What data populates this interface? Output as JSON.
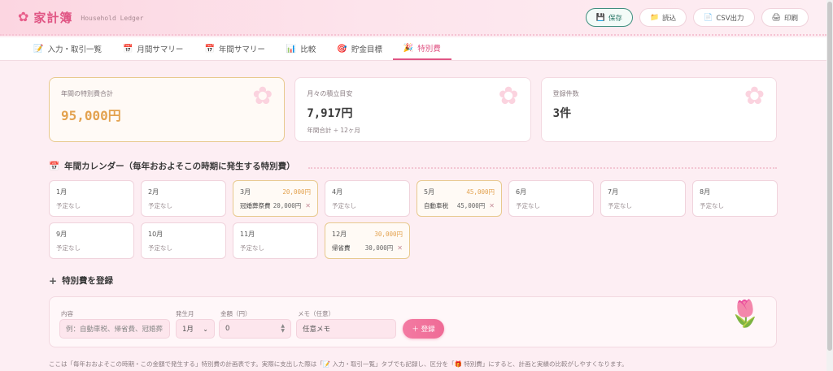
{
  "app": {
    "title": "家計簿",
    "subtitle": "Household Ledger"
  },
  "header_buttons": {
    "save": "保存",
    "load": "読込",
    "csv": "CSV出力",
    "print": "印刷"
  },
  "tabs": [
    {
      "label": "入力・取引一覧",
      "icon": "memo-icon"
    },
    {
      "label": "月間サマリー",
      "icon": "calendar-icon"
    },
    {
      "label": "年間サマリー",
      "icon": "calendar-icon"
    },
    {
      "label": "比較",
      "icon": "bar-chart-icon"
    },
    {
      "label": "貯金目標",
      "icon": "target-icon"
    },
    {
      "label": "特別費",
      "icon": "party-popper-icon",
      "active": true
    }
  ],
  "summary": {
    "annual": {
      "label": "年間の特別費合計",
      "value": "95,000円"
    },
    "monthly": {
      "label": "月々の積立目安",
      "value": "7,917円",
      "note": "年間合計 ÷ 12ヶ月"
    },
    "count": {
      "label": "登録件数",
      "value": "3件"
    }
  },
  "calendar": {
    "title": "年間カレンダー（毎年おおよそこの時期に発生する特別費）",
    "none_label": "予定なし",
    "months": [
      {
        "name": "1月"
      },
      {
        "name": "2月"
      },
      {
        "name": "3月",
        "total": "20,000円",
        "items": [
          {
            "name": "冠婚葬祭費",
            "amount": "20,000円"
          }
        ]
      },
      {
        "name": "4月"
      },
      {
        "name": "5月",
        "total": "45,000円",
        "items": [
          {
            "name": "自動車税",
            "amount": "45,000円"
          }
        ]
      },
      {
        "name": "6月"
      },
      {
        "name": "7月"
      },
      {
        "name": "8月"
      },
      {
        "name": "9月"
      },
      {
        "name": "10月"
      },
      {
        "name": "11月"
      },
      {
        "name": "12月",
        "total": "30,000円",
        "items": [
          {
            "name": "帰省費",
            "amount": "30,000円"
          }
        ]
      }
    ]
  },
  "register": {
    "title": "特別費を登録",
    "content_label": "内容",
    "content_placeholder": "例：自動車税、帰省費、冠婚葬",
    "month_label": "発生月",
    "month_value": "1月",
    "amount_label": "金額（円）",
    "amount_value": "0",
    "memo_label": "メモ（任意）",
    "memo_placeholder": "任意メモ",
    "submit": "＋ 登録"
  },
  "footnote": "ここは「毎年おおよそこの時期・この金額で発生する」特別費の計画表です。実際に支出した際は「📝 入力・取引一覧」タブでも記録し、区分を「🎁 特別費」にすると、計画と実績の比較がしやすくなります。",
  "colors": {
    "accent": "#e05584",
    "highlight": "#e3a24f",
    "save": "#2e7a6b"
  }
}
